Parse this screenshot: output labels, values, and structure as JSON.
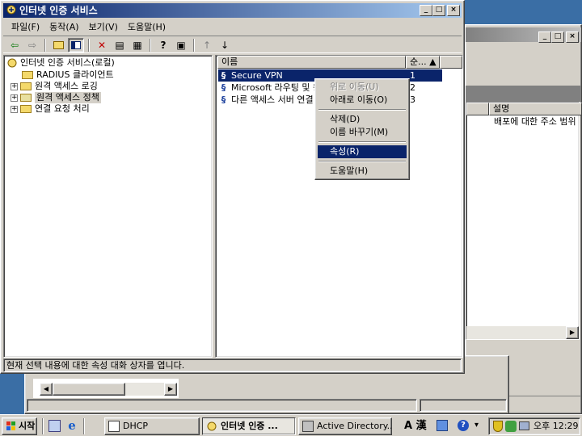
{
  "main_window": {
    "title": "인터넷 인증 서비스",
    "menu": [
      "파일(F)",
      "동작(A)",
      "보기(V)",
      "도움말(H)"
    ],
    "tree": {
      "root": "인터넷 인증 서비스(로컬)",
      "items": [
        "RADIUS 클라이언트",
        "원격 액세스 로깅",
        "원격 액세스 정책",
        "연결 요청 처리"
      ]
    },
    "columns": {
      "name": "이름",
      "order": "순... ▲"
    },
    "rows": [
      {
        "name": "Secure VPN",
        "order": "1"
      },
      {
        "name": "Microsoft 라우팅 및 원",
        "order": "2"
      },
      {
        "name": "다른 액세스 서버 연결",
        "order": "3"
      }
    ],
    "status": "현재 선택 내용에 대한 속성 대화 상자를 엽니다."
  },
  "context_menu": {
    "move_up": "위로 이동(U)",
    "move_down": "아래로 이동(O)",
    "delete": "삭제(D)",
    "rename": "이름 바꾸기(M)",
    "properties": "속성(R)",
    "help": "도움말(H)"
  },
  "background_window": {
    "column": "설명",
    "cell": "배포에 대한 주소 범위"
  },
  "taskbar": {
    "start": "시작",
    "tasks": [
      "DHCP",
      "인터넷 인증 ...",
      "Active Directory..."
    ],
    "tray_lang": "A 漢",
    "clock": "오후 12:29"
  },
  "colors": {
    "title_active": "#0a246a",
    "selection": "#0a246a",
    "desktop": "#3a6ea5",
    "face": "#d4d0c8"
  }
}
